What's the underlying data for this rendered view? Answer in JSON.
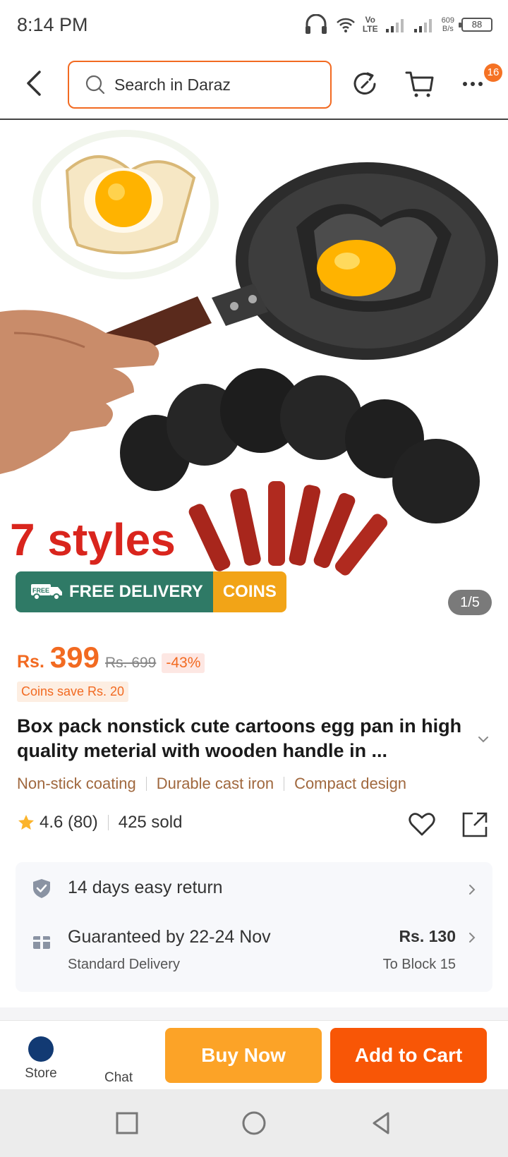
{
  "status_bar": {
    "time": "8:14 PM",
    "lte_top": "Vo",
    "lte_bottom": "LTE",
    "net_speed_value": "609",
    "net_speed_unit": "B/s",
    "battery": "88"
  },
  "header": {
    "search_placeholder": "Search in Daraz",
    "cart_badge": "16"
  },
  "hero": {
    "delivery_label": "FREE DELIVERY",
    "delivery_badge": "FREE",
    "coins_label": "COINS",
    "image_counter": "1/5",
    "image_text": "7 styles"
  },
  "product": {
    "currency": "Rs.",
    "price": "399",
    "original_price": "Rs. 699",
    "discount": "-43%",
    "coins_save": "Coins save Rs. 20",
    "title": "Box pack nonstick cute cartoons egg pan in high quality meterial with wooden handle in ...",
    "tags": [
      "Non-stick coating",
      "Durable cast iron",
      "Compact design"
    ],
    "rating": "4.6 (80)",
    "sold": "425 sold"
  },
  "services": {
    "return_label": "14 days easy return",
    "guarantee_label": "Guaranteed by 22-24 Nov",
    "delivery_type": "Standard Delivery",
    "delivery_fee": "Rs. 130",
    "delivery_location": "To Block 15"
  },
  "action_bar": {
    "store_label": "Store",
    "chat_label": "Chat",
    "buy_now": "Buy Now",
    "add_to_cart": "Add to Cart"
  },
  "colors": {
    "accent": "#f26a21",
    "buy_now": "#fca327",
    "add_to_cart": "#f85606",
    "delivery_green": "#2f7a66",
    "coins_yellow": "#f2a417"
  }
}
